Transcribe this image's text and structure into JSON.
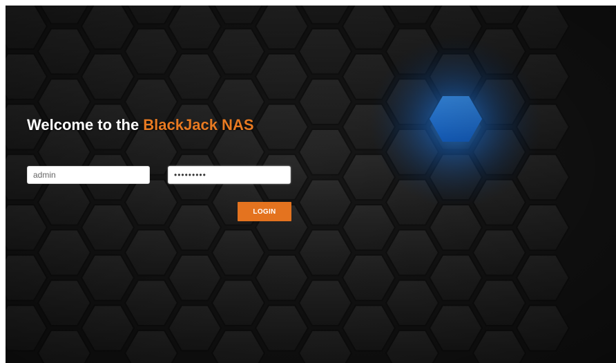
{
  "welcome": {
    "prefix": "Welcome to the ",
    "brand": "BlackJack NAS"
  },
  "login_form": {
    "username_value": "admin",
    "password_value": "•••••••••",
    "login_label": "LOGIN"
  },
  "colors": {
    "accent": "#e4731f",
    "brand_text": "#e87a22",
    "glow": "#1a7fe8",
    "background": "#161616"
  }
}
